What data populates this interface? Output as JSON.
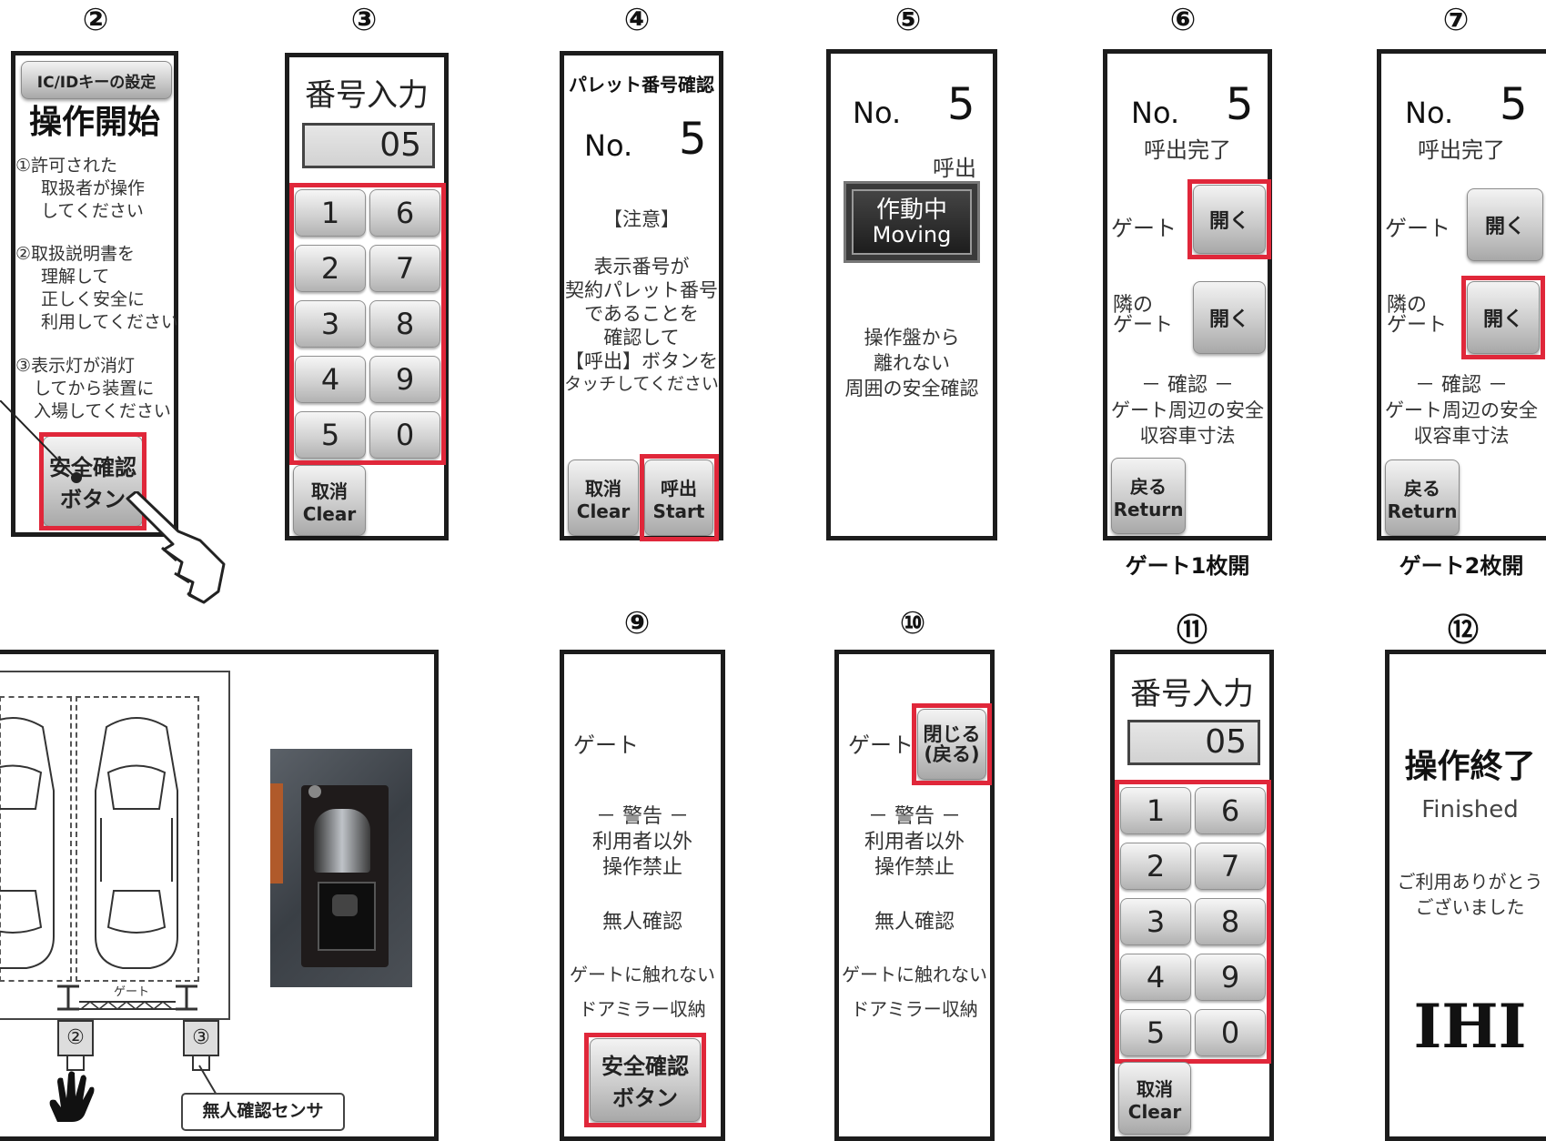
{
  "steps": {
    "s2": "②",
    "s3": "③",
    "s4": "④",
    "s5": "⑤",
    "s6": "⑥",
    "s7": "⑦",
    "s9": "⑨",
    "s10": "⑩",
    "s11": "⑪",
    "s12": "⑫"
  },
  "p2": {
    "tab": "IC/IDキーの設定",
    "title": "操作開始",
    "notes": [
      "①許可された",
      "取扱者が操作",
      "してください",
      "②取扱説明書を",
      "理解して",
      "正しく安全に",
      "利用してください",
      "③表示灯が消灯",
      "してから装置に",
      "入場してください"
    ],
    "btn1": "安全確認",
    "btn2": "ボタン"
  },
  "p3": {
    "title": "番号入力",
    "display": "05",
    "keys": [
      "1",
      "6",
      "2",
      "7",
      "3",
      "8",
      "4",
      "9",
      "5",
      "0"
    ],
    "clear1": "取消",
    "clear2": "Clear"
  },
  "p4": {
    "title": "パレット番号確認",
    "no": "No.",
    "num": "5",
    "notice": "【注意】",
    "msg": [
      "表示番号が",
      "契約パレット番号",
      "であることを",
      "確認して",
      "【呼出】ボタンを",
      "タッチしてください"
    ],
    "clear1": "取消",
    "clear2": "Clear",
    "start1": "呼出",
    "start2": "Start"
  },
  "p5": {
    "no": "No.",
    "num": "5",
    "call": "呼出",
    "moving1": "作動中",
    "moving2": "Moving",
    "msg": [
      "操作盤から",
      "離れない",
      "周囲の安全確認"
    ]
  },
  "p6": {
    "no": "No.",
    "num": "5",
    "done": "呼出完了",
    "gate": "ゲート",
    "open": "開く",
    "next1": "隣の",
    "next2": "ゲート",
    "open2": "開く",
    "confirm": "－ 確認 －",
    "c1": "ゲート周辺の安全",
    "c2": "収容車寸法",
    "ret1": "戻る",
    "ret2": "Return",
    "caption": "ゲート1枚開"
  },
  "p7": {
    "no": "No.",
    "num": "5",
    "done": "呼出完了",
    "gate": "ゲート",
    "open": "開く",
    "next1": "隣の",
    "next2": "ゲート",
    "open2": "開く",
    "confirm": "－ 確認 －",
    "c1": "ゲート周辺の安全",
    "c2": "収容車寸法",
    "ret1": "戻る",
    "ret2": "Return",
    "caption": "ゲート2枚開"
  },
  "diagram": {
    "gate": "ゲート",
    "m2": "②",
    "m3": "③",
    "sensor": "無人確認センサ"
  },
  "p9": {
    "gate": "ゲート",
    "warn": "－ 警告 －",
    "w1": "利用者以外",
    "w2": "操作禁止",
    "unmanned": "無人確認",
    "touch": "ゲートに触れない",
    "mirror": "ドアミラー収納",
    "btn1": "安全確認",
    "btn2": "ボタン"
  },
  "p10": {
    "gate": "ゲート",
    "close1": "閉じる",
    "close2": "(戻る)",
    "warn": "－ 警告 －",
    "w1": "利用者以外",
    "w2": "操作禁止",
    "unmanned": "無人確認",
    "touch": "ゲートに触れない",
    "mirror": "ドアミラー収納"
  },
  "p11": {
    "title": "番号入力",
    "display": "05",
    "keys": [
      "1",
      "6",
      "2",
      "7",
      "3",
      "8",
      "4",
      "9",
      "5",
      "0"
    ],
    "clear1": "取消",
    "clear2": "Clear"
  },
  "p12": {
    "title": "操作終了",
    "sub": "Finished",
    "thanks1": "ご利用ありがとう",
    "thanks2": "ございました",
    "logo": "IHI"
  },
  "colors": {
    "highlight": "#e0273a",
    "frame": "#1c1c1c",
    "moving_bg": "#2b2b2b"
  }
}
